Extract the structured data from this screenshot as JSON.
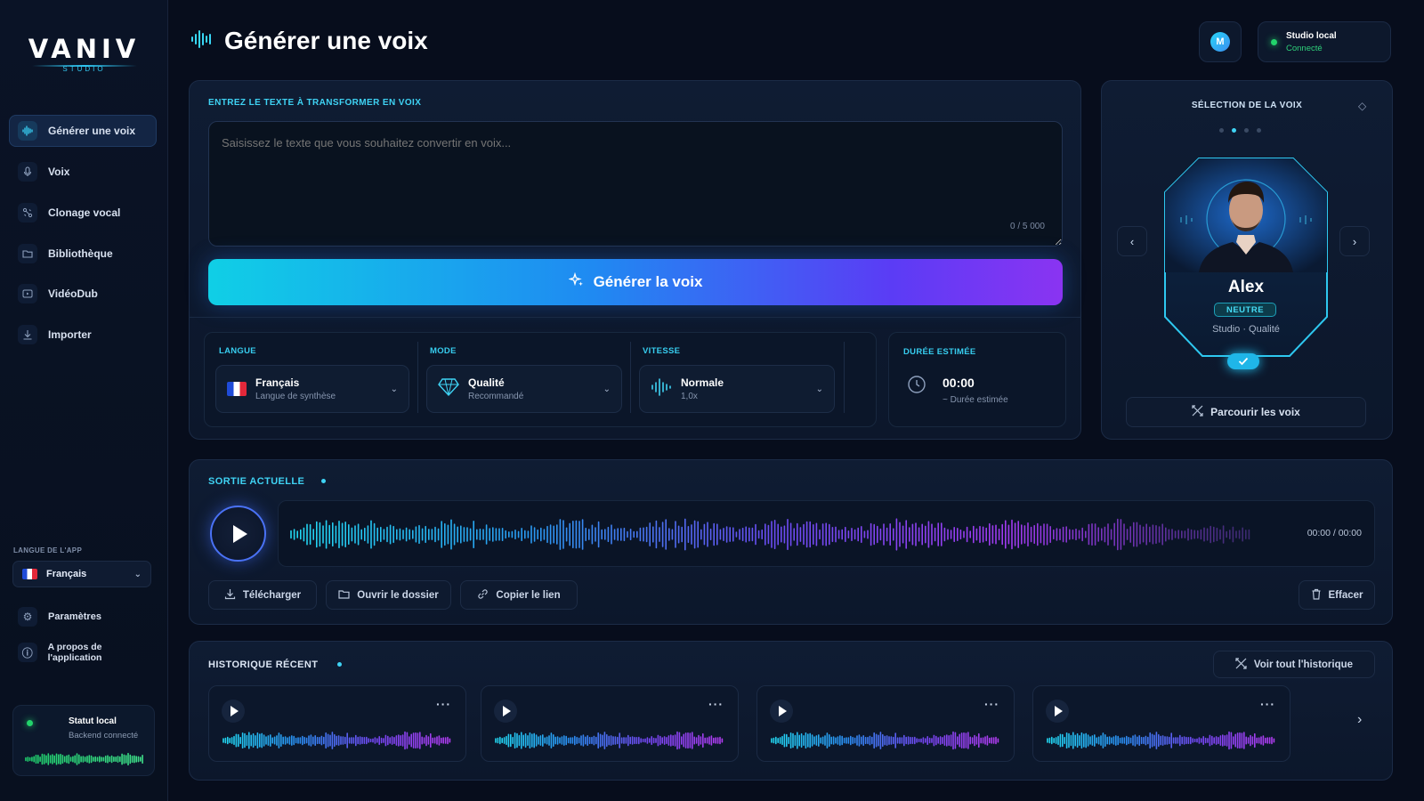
{
  "app": {
    "logo": "VANIV",
    "logo_sub": "STUDIO"
  },
  "sidebar": {
    "items": [
      {
        "label": "Générer une voix",
        "icon": "waveform-icon",
        "active": true
      },
      {
        "label": "Voix",
        "icon": "microphone-icon"
      },
      {
        "label": "Clonage vocal",
        "icon": "clone-icon"
      },
      {
        "label": "Bibliothèque",
        "icon": "folder-icon"
      },
      {
        "label": "VidéoDub",
        "icon": "video-icon"
      },
      {
        "label": "Importer",
        "icon": "download-icon"
      }
    ],
    "app_language_label": "LANGUE DE L'APP",
    "app_language_value": "Français",
    "settings_label": "Paramètres",
    "about_label": "A propos de l'application",
    "status_title": "Statut local",
    "status_sub": "Backend connecté"
  },
  "header": {
    "title": "Générer une voix",
    "avatar_letter": "M",
    "studio_title": "Studio local",
    "studio_status": "Connecté"
  },
  "input": {
    "section_title": "ENTREZ LE TEXTE À TRANSFORMER EN VOIX",
    "placeholder": "Saisissez le texte que vous souhaitez convertir en voix...",
    "char_count": "0 / 5 000",
    "generate_label": "Générer la voix"
  },
  "options": {
    "language": {
      "label": "LANGUE",
      "value": "Français",
      "sub": "Langue de synthèse"
    },
    "mode": {
      "label": "MODE",
      "value": "Qualité",
      "sub": "Recommandé"
    },
    "speed": {
      "label": "VITESSE",
      "value": "Normale",
      "sub": "1,0x"
    },
    "duration": {
      "label": "DURÉE ESTIMÉE",
      "value": "00:00",
      "sub": "~ Durée estimée"
    }
  },
  "voice": {
    "section_title": "SÉLECTION DE LA VOIX",
    "name": "Alex",
    "tag": "NEUTRE",
    "desc": "Studio · Qualité",
    "browse_label": "Parcourir les voix",
    "pager_count": 4,
    "pager_active": 2
  },
  "output": {
    "section_title": "SORTIE ACTUELLE",
    "time": "00:00 / 00:00",
    "download_label": "Télécharger",
    "open_folder_label": "Ouvrir le dossier",
    "copy_link_label": "Copier le lien",
    "clear_label": "Effacer"
  },
  "history": {
    "section_title": "HISTORIQUE RÉCENT",
    "view_all_label": "Voir tout l'historique",
    "items_count": 4
  },
  "colors": {
    "accent": "#38d6f6",
    "purple": "#8a34f2",
    "bg": "#070d1c",
    "success": "#22d36b"
  }
}
